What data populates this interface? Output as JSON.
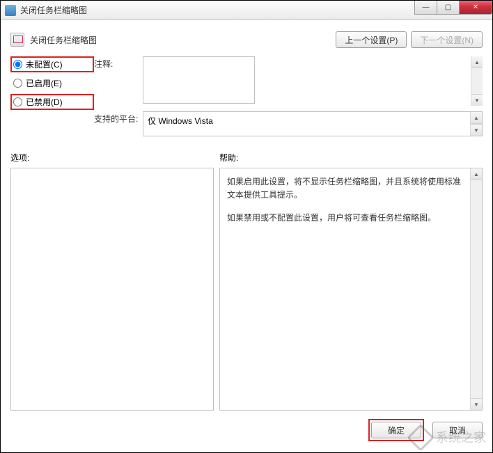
{
  "titlebar": {
    "title": "关闭任务栏缩略图"
  },
  "header": {
    "page_title": "关闭任务栏缩略图",
    "prev_setting": "上一个设置(P)",
    "next_setting": "下一个设置(N)"
  },
  "radios": {
    "not_configured": "未配置(C)",
    "enabled": "已启用(E)",
    "disabled": "已禁用(D)"
  },
  "fields": {
    "comment_label": "注释:",
    "comment_value": "",
    "platform_label": "支持的平台:",
    "platform_value": "仅 Windows Vista"
  },
  "sections": {
    "options_label": "选项:",
    "help_label": "帮助:"
  },
  "help": {
    "p1": "如果启用此设置，将不显示任务栏缩略图，并且系统将使用标准文本提供工具提示。",
    "p2": "如果禁用或不配置此设置，用户将可查看任务栏缩略图。"
  },
  "footer": {
    "ok": "确定",
    "cancel": "取消"
  },
  "watermark": {
    "text": "系统之家"
  }
}
